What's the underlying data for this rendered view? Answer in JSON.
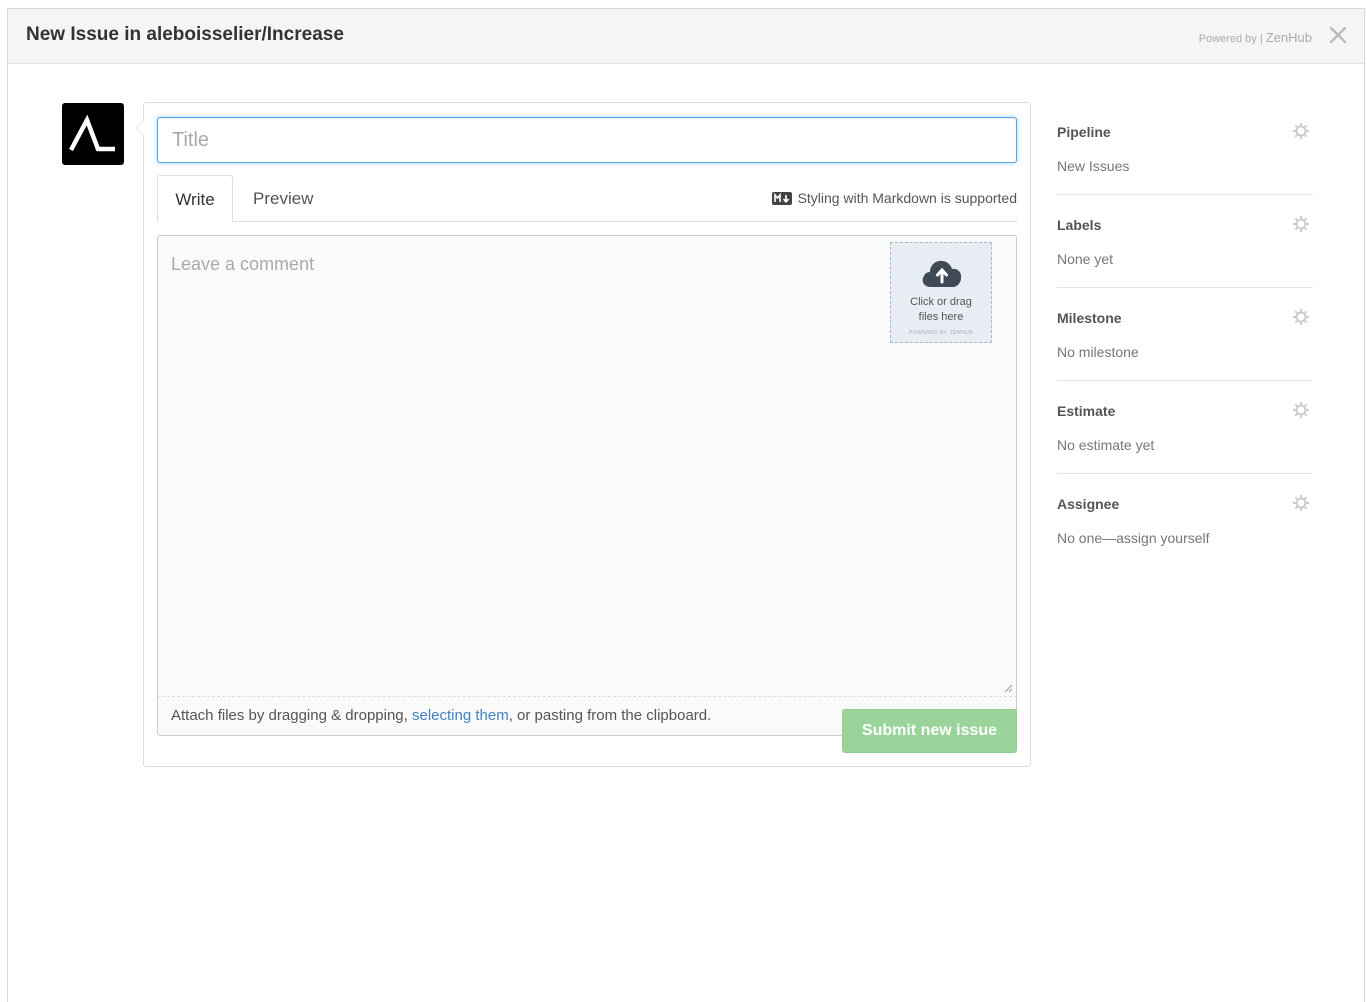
{
  "modal": {
    "title": "New Issue in aleboisselier/Increase",
    "powered_prefix": "Powered by | ",
    "powered_brand": "ZenHub",
    "close_icon": "close-icon"
  },
  "form": {
    "title_placeholder": "Title",
    "tabs": [
      {
        "label": "Write",
        "active": true
      },
      {
        "label": "Preview",
        "active": false
      }
    ],
    "markdown_hint": "Styling with Markdown is supported",
    "comment_placeholder": "Leave a comment",
    "upload": {
      "line1": "Click or drag",
      "line2": "files here",
      "powered": "POWERED BY ZENHUB"
    },
    "attach": {
      "prefix": "Attach files by dragging & dropping, ",
      "link": "selecting them",
      "suffix": ", or pasting from the clipboard."
    },
    "submit_label": "Submit new issue"
  },
  "sidebar": {
    "sections": [
      {
        "label": "Pipeline",
        "value": "New Issues"
      },
      {
        "label": "Labels",
        "value": "None yet"
      },
      {
        "label": "Milestone",
        "value": "No milestone"
      },
      {
        "label": "Estimate",
        "value": "No estimate yet"
      },
      {
        "label": "Assignee",
        "value": "No one—assign yourself"
      }
    ]
  },
  "colors": {
    "focus_border": "#51a7e8",
    "link": "#4183c4",
    "submit_disabled": "#9bd49b"
  }
}
